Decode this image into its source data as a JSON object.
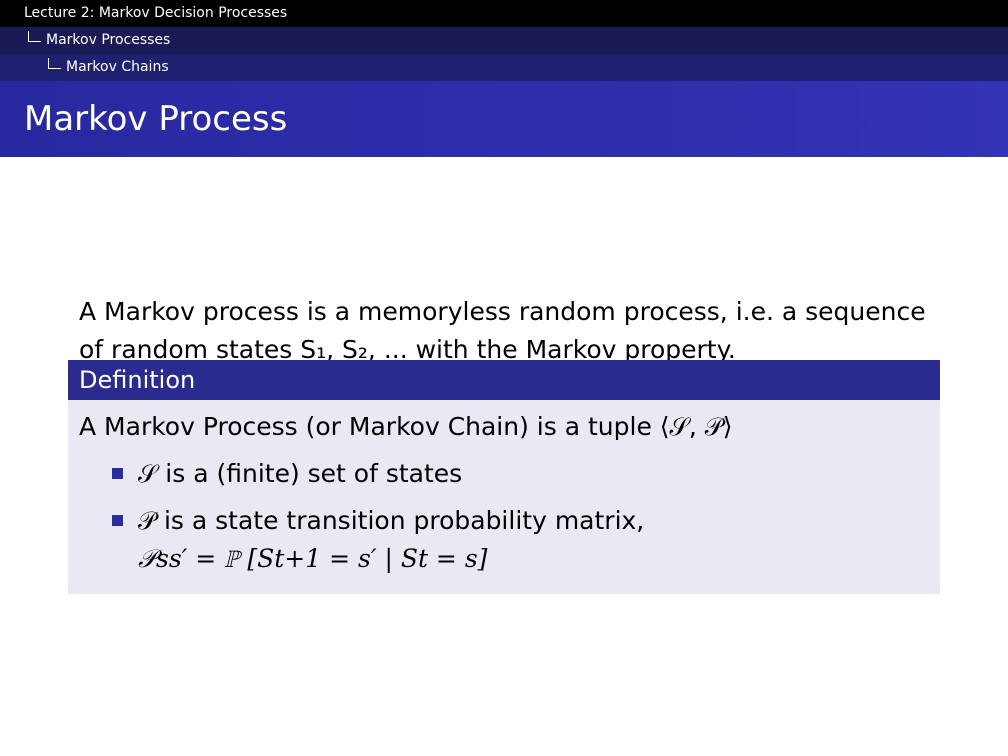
{
  "navigation": {
    "level_1": "Lecture 2: Markov Decision Processes",
    "level_2": "Markov Processes",
    "level_3": "Markov Chains"
  },
  "slide": {
    "title": "Markov Process",
    "intro": "A Markov process is a memoryless random process, i.e. a sequence of random states S₁, S₂, ... with the Markov property."
  },
  "definition": {
    "heading": "Definition",
    "statement": "A Markov Process (or Markov Chain) is a tuple ⟨𝒮, 𝒫⟩",
    "bullets": [
      {
        "text": "𝒮 is a (finite) set of states"
      },
      {
        "text": "𝒫 is a state transition probability matrix,",
        "formula": "𝒫ss′ = ℙ [St+1 = s′ | St = s]"
      }
    ]
  },
  "colors": {
    "header_black": "#000000",
    "header_navy": "#1a1a56",
    "header_blue": "#202070",
    "title_blue": "#3333b5",
    "definition_blue": "#2a2a8f",
    "definition_background": "#e9e9f3",
    "bullet_blue": "#2c2ca0"
  },
  "icons": {
    "bullet": "square-bullet-icon",
    "tree": "tree-corner-icon"
  }
}
